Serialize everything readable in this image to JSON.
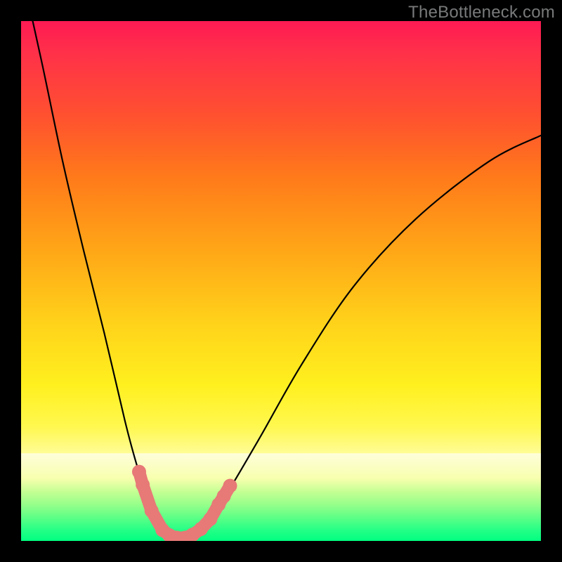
{
  "watermark": "TheBottleneck.com",
  "colors": {
    "border": "#000000",
    "curve": "#000000",
    "marker": "#e77977",
    "gradient_top": "#ff1a54",
    "gradient_mid": "#fff01f",
    "gradient_bottom": "#00ff80"
  },
  "chart_data": {
    "type": "line",
    "title": "",
    "xlabel": "",
    "ylabel": "",
    "xlim": [
      0,
      100
    ],
    "ylim": [
      0,
      100
    ],
    "series": [
      {
        "name": "bottleneck-curve",
        "x": [
          0,
          4,
          8,
          12,
          16,
          20,
          22,
          24,
          25,
          26,
          27,
          28,
          29,
          30,
          31,
          32,
          34,
          36,
          40,
          46,
          54,
          64,
          76,
          90,
          100
        ],
        "y": [
          110,
          92,
          73,
          56,
          40,
          23,
          15.5,
          9,
          6.2,
          4.0,
          2.4,
          1.4,
          0.8,
          0.5,
          0.5,
          0.7,
          1.8,
          3.8,
          9.8,
          20,
          34,
          49,
          62,
          73,
          78
        ]
      }
    ],
    "markers": {
      "name": "highlighted-points",
      "points": [
        {
          "x": 22.7,
          "y": 13.3
        },
        {
          "x": 23.4,
          "y": 10.8
        },
        {
          "x": 25.1,
          "y": 5.8
        },
        {
          "x": 27.2,
          "y": 2.1
        },
        {
          "x": 28.5,
          "y": 1.1
        },
        {
          "x": 30.0,
          "y": 0.6
        },
        {
          "x": 31.5,
          "y": 0.6
        },
        {
          "x": 33.0,
          "y": 1.2
        },
        {
          "x": 34.6,
          "y": 2.3
        },
        {
          "x": 36.4,
          "y": 4.2
        },
        {
          "x": 38.0,
          "y": 7.0
        },
        {
          "x": 39.0,
          "y": 8.6
        },
        {
          "x": 40.2,
          "y": 10.6
        }
      ]
    },
    "background_gradient_meaning": "vertical value scale from high (red, top) to low (green, bottom)"
  }
}
